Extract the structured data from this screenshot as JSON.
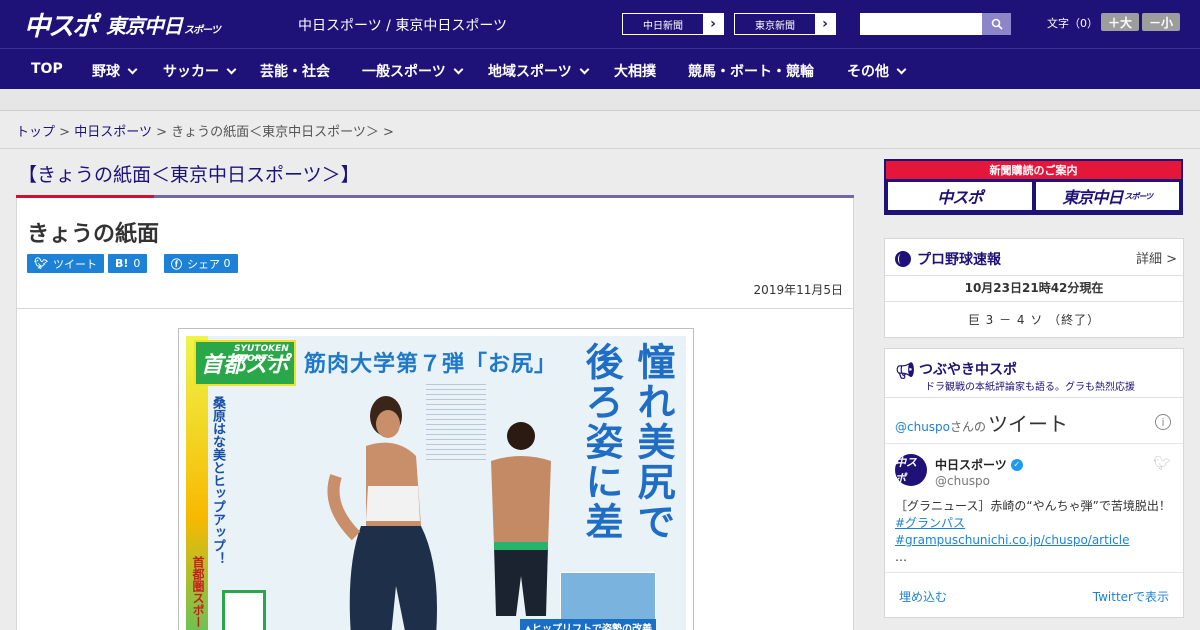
{
  "header": {
    "logo_main": "中スポ",
    "logo_sub": "東京中日",
    "logo_sub_small": "スポーツ",
    "site_title": "中日スポーツ / 東京中日スポーツ",
    "paper_links": [
      "中日新聞",
      "東京新聞"
    ],
    "search_placeholder": "",
    "font_label": "文字（0）",
    "size_up": "＋大",
    "size_down": "－小"
  },
  "nav": {
    "items": [
      {
        "label": "TOP",
        "has_menu": false
      },
      {
        "label": "野球",
        "has_menu": true
      },
      {
        "label": "サッカー",
        "has_menu": true
      },
      {
        "label": "芸能・社会",
        "has_menu": false
      },
      {
        "label": "一般スポーツ",
        "has_menu": true
      },
      {
        "label": "地域スポーツ",
        "has_menu": true
      },
      {
        "label": "大相撲",
        "has_menu": false
      },
      {
        "label": "競馬・ボート・競輪",
        "has_menu": false
      },
      {
        "label": "その他",
        "has_menu": true
      }
    ]
  },
  "breadcrumb": {
    "items": [
      "トップ",
      "中日スポーツ"
    ],
    "current": "きょうの紙面＜東京中日スポーツ＞",
    "sep": ">"
  },
  "main": {
    "section_title": "【きょうの紙面＜東京中日スポーツ＞】",
    "article_title": "きょうの紙面",
    "share": {
      "tweet": "ツイート",
      "hatena_icon": "B!",
      "hatena_count": "0",
      "facebook": "シェア",
      "facebook_count": "0"
    },
    "date": "2019年11月5日",
    "paper_image": {
      "logo": "首都スポ",
      "logo_small": "SYUTOKEN SPORTS",
      "headline": "筋肉大学第７弾「お尻」",
      "vertical_cols": [
        "憧れ美尻で",
        "後ろ姿に差"
      ],
      "side_text": "桑原はな美とヒップアップ！",
      "side_text2": "首都圏スポーツ",
      "caption": "▲ヒップリフトで姿勢の改善"
    }
  },
  "sidebar": {
    "subscription": {
      "banner": "新聞購読のご案内",
      "btn1": "中スポ",
      "btn2": "東京中日",
      "btn2_small": "スポーツ"
    },
    "baseball": {
      "title": "プロ野球速報",
      "detail": "詳細 >",
      "time": "10月23日21時42分現在",
      "score": "巨 3 － 4 ソ （終了）"
    },
    "twitter": {
      "title": "つぶやき中スポ",
      "subtitle": "ドラ観戦の本紙評論家も語る。グラも熱烈応援",
      "handle_prefix": "@chuspo",
      "handle_suffix": "さんの",
      "tweets_label": "ツイート",
      "account_name": "中日スポーツ",
      "account_handle": "@chuspo",
      "avatar_text": "中スポ",
      "tweet_text": "［グラニュース］赤崎の“やんちゃ弾”で苦境脱出！",
      "tweet_link": "#グランパス #grampuschunichi.co.jp/chuspo/article",
      "tweet_more": "…",
      "embed": "埋め込む",
      "view_on": "Twitterで表示"
    }
  },
  "colors": {
    "brand": "#1e1278",
    "accent_red": "#e4173b",
    "share_blue": "#1d82d6"
  }
}
